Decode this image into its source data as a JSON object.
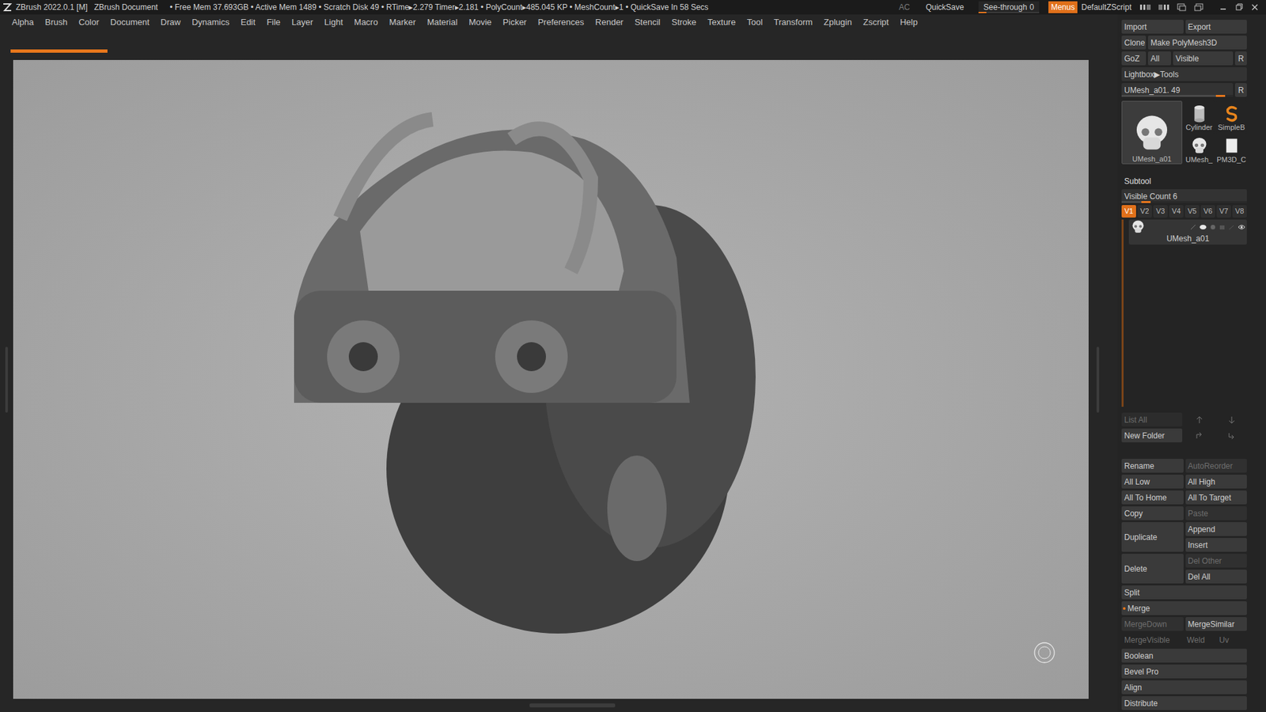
{
  "title_bar": {
    "app": "ZBrush 2022.0.1 [M]",
    "document": "ZBrush Document",
    "stats": "• Free Mem 37.693GB • Active Mem 1489 • Scratch Disk 49 • RTime▸2.279 Timer▸2.181 • PolyCount▸485.045 KP • MeshCount▸1 • QuickSave In 58 Secs",
    "ac": "AC",
    "quicksave": "QuickSave",
    "see_through": {
      "label": "See-through",
      "value": "0",
      "level": 0
    },
    "menus": {
      "label": "Menus",
      "on": true
    },
    "script": "DefaultZScript"
  },
  "menu_bar": [
    "Alpha",
    "Brush",
    "Color",
    "Document",
    "Draw",
    "Dynamics",
    "Edit",
    "File",
    "Layer",
    "Light",
    "Macro",
    "Marker",
    "Material",
    "Movie",
    "Picker",
    "Preferences",
    "Render",
    "Stencil",
    "Stroke",
    "Texture",
    "Tool",
    "Transform",
    "Zplugin",
    "Zscript",
    "Help"
  ],
  "progress": {
    "level": 0.09
  },
  "tool_panel": {
    "top_rows": [
      [
        {
          "label": "Import"
        },
        {
          "label": "Export"
        }
      ],
      [
        {
          "label": "Clone"
        },
        {
          "label": "Make PolyMesh3D"
        }
      ],
      [
        {
          "label": "GoZ"
        },
        {
          "label": "All"
        },
        {
          "label": "Visible"
        },
        {
          "label": "R"
        }
      ]
    ],
    "lightbox": "Lightbox▶Tools",
    "tool_slider": {
      "label": "UMesh_a01. 49",
      "level": 0.93,
      "reset": "R"
    },
    "thumbnails": [
      {
        "label": "UMesh_a01",
        "selected": true,
        "kind": "skull"
      },
      {
        "label": "Cylinder",
        "selected": false,
        "kind": "cylinder"
      },
      {
        "label": "SimpleB",
        "selected": false,
        "kind": "spiral"
      },
      {
        "label": "UMesh_",
        "selected": false,
        "kind": "skull"
      },
      {
        "label": "PM3D_C",
        "selected": false,
        "kind": "plane"
      }
    ],
    "subtool": {
      "title": "Subtool",
      "visible_count": {
        "label": "Visible Count 6",
        "level": 0.23
      },
      "versions": [
        {
          "label": "V1",
          "selected": true
        },
        {
          "label": "V2",
          "selected": false
        },
        {
          "label": "V3",
          "selected": false
        },
        {
          "label": "V4",
          "selected": false
        },
        {
          "label": "V5",
          "selected": false
        },
        {
          "label": "V6",
          "selected": false
        },
        {
          "label": "V7",
          "selected": false
        },
        {
          "label": "V8",
          "selected": false
        }
      ],
      "items": [
        {
          "name": "UMesh_a01",
          "selected": true,
          "visible": true
        }
      ],
      "list_all": "List All",
      "new_folder": "New Folder"
    },
    "actions": [
      {
        "kind": "pair",
        "cells": [
          {
            "label": "Rename",
            "disabled": false
          },
          {
            "label": "AutoReorder",
            "disabled": true
          }
        ]
      },
      {
        "kind": "pair",
        "cells": [
          {
            "label": "All Low",
            "disabled": false
          },
          {
            "label": "All High",
            "disabled": false
          }
        ]
      },
      {
        "kind": "pair",
        "cells": [
          {
            "label": "All To Home",
            "disabled": false
          },
          {
            "label": "All To Target",
            "disabled": false
          }
        ]
      },
      {
        "kind": "pair",
        "cells": [
          {
            "label": "Copy",
            "disabled": false
          },
          {
            "label": "Paste",
            "disabled": true
          }
        ]
      },
      {
        "kind": "tall",
        "cells": [
          {
            "label": "Duplicate",
            "disabled": false
          },
          {
            "label": "Append",
            "disabled": false
          },
          {
            "label": "Insert",
            "disabled": false
          }
        ]
      },
      {
        "kind": "tall",
        "cells": [
          {
            "label": "Delete",
            "disabled": false
          },
          {
            "label": "Del Other",
            "disabled": true
          },
          {
            "label": "Del All",
            "disabled": false
          }
        ]
      },
      {
        "kind": "full",
        "cells": [
          {
            "label": "Split",
            "disabled": false
          }
        ]
      },
      {
        "kind": "full",
        "cells": [
          {
            "label": "Merge",
            "disabled": false,
            "expanded": true
          }
        ]
      },
      {
        "kind": "pair",
        "cells": [
          {
            "label": "MergeDown",
            "disabled": true
          },
          {
            "label": "MergeSimilar",
            "disabled": false
          }
        ]
      },
      {
        "kind": "triple",
        "cells": [
          {
            "label": "MergeVisible",
            "disabled": true
          },
          {
            "label": "Weld",
            "disabled": true
          },
          {
            "label": "Uv",
            "disabled": true
          }
        ]
      },
      {
        "kind": "full",
        "cells": [
          {
            "label": "Boolean",
            "disabled": false
          }
        ]
      },
      {
        "kind": "full",
        "cells": [
          {
            "label": "Bevel Pro",
            "disabled": false
          }
        ]
      },
      {
        "kind": "full",
        "cells": [
          {
            "label": "Align",
            "disabled": false
          }
        ]
      },
      {
        "kind": "full",
        "cells": [
          {
            "label": "Distribute",
            "disabled": false
          }
        ]
      }
    ]
  }
}
